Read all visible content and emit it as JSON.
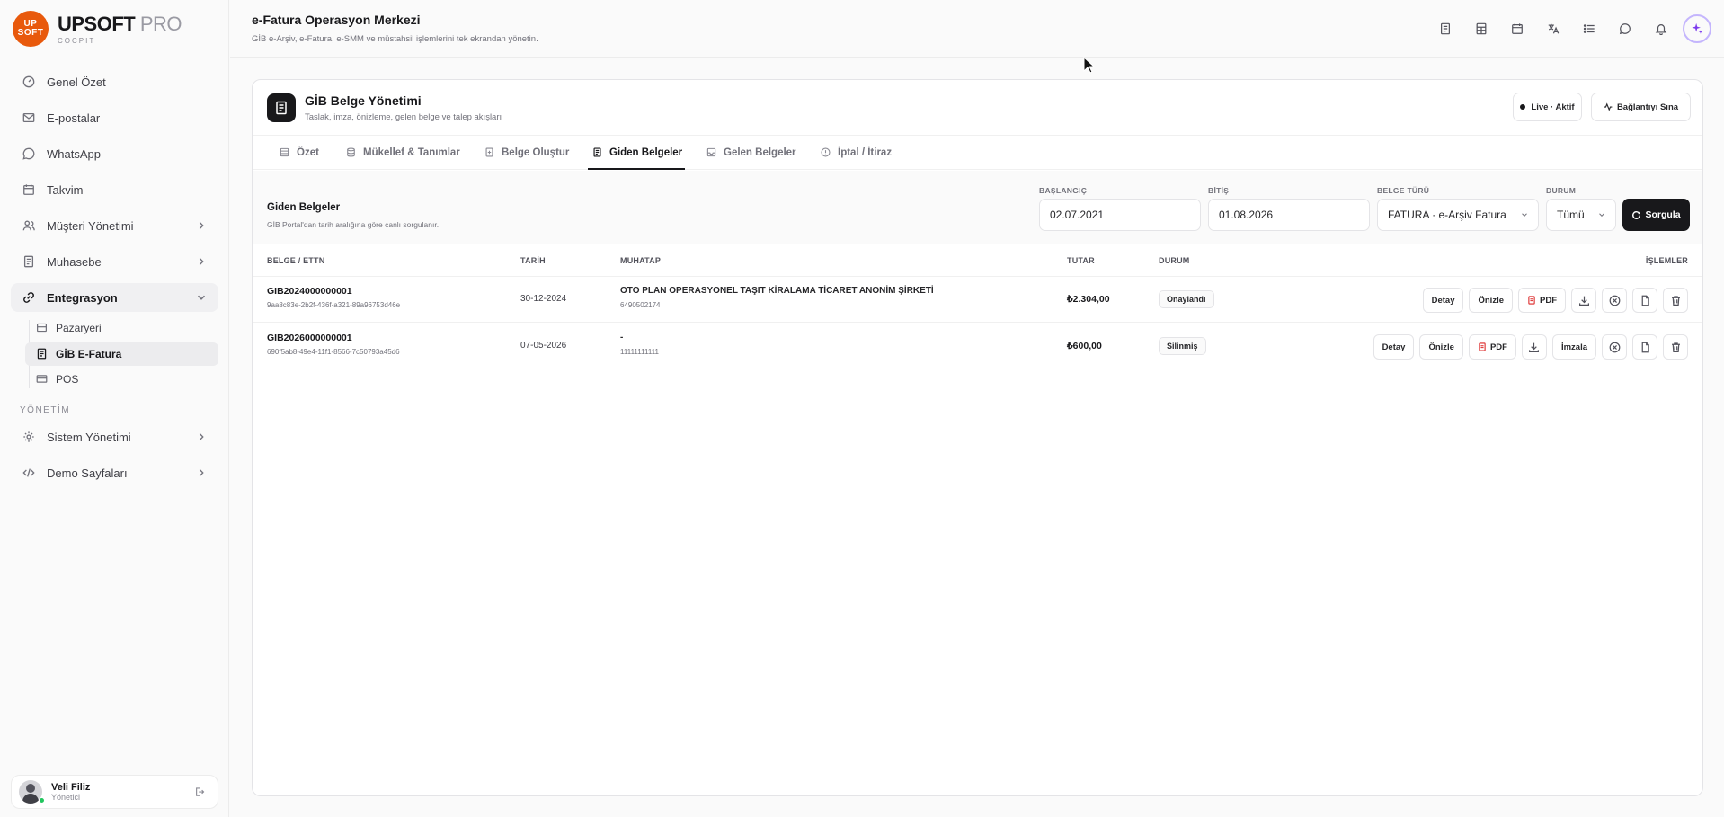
{
  "brand": {
    "logo_top": "UP",
    "logo_bottom": "SOFT",
    "name": "UPSOFT",
    "name_suffix": "PRO",
    "sub": "COCPIT"
  },
  "sidebar": {
    "items": [
      {
        "label": "Genel Özet",
        "icon": "dashboard-icon"
      },
      {
        "label": "E-postalar",
        "icon": "mail-icon"
      },
      {
        "label": "WhatsApp",
        "icon": "whatsapp-icon"
      },
      {
        "label": "Takvim",
        "icon": "calendar-icon"
      },
      {
        "label": "Müşteri Yönetimi",
        "icon": "users-icon"
      },
      {
        "label": "Muhasebe",
        "icon": "receipt-icon"
      },
      {
        "label": "Entegrasyon",
        "icon": "link-icon"
      }
    ],
    "sub_items": [
      {
        "label": "Pazaryeri",
        "icon": "store-icon"
      },
      {
        "label": "GİB E-Fatura",
        "icon": "document-icon"
      },
      {
        "label": "POS",
        "icon": "card-icon"
      }
    ],
    "section_label": "YÖNETİM",
    "admin_items": [
      {
        "label": "Sistem Yönetimi",
        "icon": "gear-icon"
      },
      {
        "label": "Demo Sayfaları",
        "icon": "code-icon"
      }
    ],
    "user": {
      "name": "Veli Filiz",
      "role": "Yönetici"
    }
  },
  "header": {
    "title": "e-Fatura Operasyon Merkezi",
    "subtitle": "GİB e-Arşiv, e-Fatura, e-SMM ve müstahsil işlemlerini tek ekrandan yönetin."
  },
  "panel": {
    "title": "GİB Belge Yönetimi",
    "subtitle": "Taslak, imza, önizleme, gelen belge ve talep akışları",
    "live_label": "Live · Aktif",
    "test_label": "Bağlantıyı Sına"
  },
  "tabs": [
    {
      "label": "Özet"
    },
    {
      "label": "Mükellef & Tanımlar"
    },
    {
      "label": "Belge Oluştur"
    },
    {
      "label": "Giden Belgeler"
    },
    {
      "label": "Gelen Belgeler"
    },
    {
      "label": "İptal / İtiraz"
    }
  ],
  "filter": {
    "title": "Giden Belgeler",
    "subtitle": "GİB Portal'dan tarih aralığına göre canlı sorgulanır.",
    "start_label": "BAŞLANGIÇ",
    "start_value": "02.07.2021",
    "end_label": "BİTİŞ",
    "end_value": "01.08.2026",
    "type_label": "BELGE TÜRÜ",
    "type_value": "FATURA · e-Arşiv Fatura",
    "status_label": "DURUM",
    "status_value": "Tümü",
    "query_label": "Sorgula"
  },
  "table": {
    "headers": {
      "doc": "BELGE / ETTN",
      "date": "TARİH",
      "party": "MUHATAP",
      "amount": "TUTAR",
      "status": "DURUM",
      "actions": "İŞLEMLER"
    },
    "rows": [
      {
        "doc_no": "GIB2024000000001",
        "ettn": "9aa8c83e-2b2f-436f-a321-89a96753d46e",
        "date": "30-12-2024",
        "party": "OTO PLAN OPERASYONEL TAŞIT KİRALAMA TİCARET ANONİM ŞİRKETİ",
        "vkn": "6490502174",
        "amount": "₺2.304,00",
        "status": "Onaylandı",
        "btn_detail": "Detay",
        "btn_preview": "Önizle",
        "btn_pdf": "PDF"
      },
      {
        "doc_no": "GIB2026000000001",
        "ettn": "690f5ab8-49e4-11f1-8566-7c50793a45d6",
        "date": "07-05-2026",
        "party": "-",
        "vkn": "11111111111",
        "amount": "₺600,00",
        "status": "Silinmiş",
        "btn_detail": "Detay",
        "btn_preview": "Önizle",
        "btn_pdf": "PDF",
        "btn_sign": "İmzala"
      }
    ]
  }
}
